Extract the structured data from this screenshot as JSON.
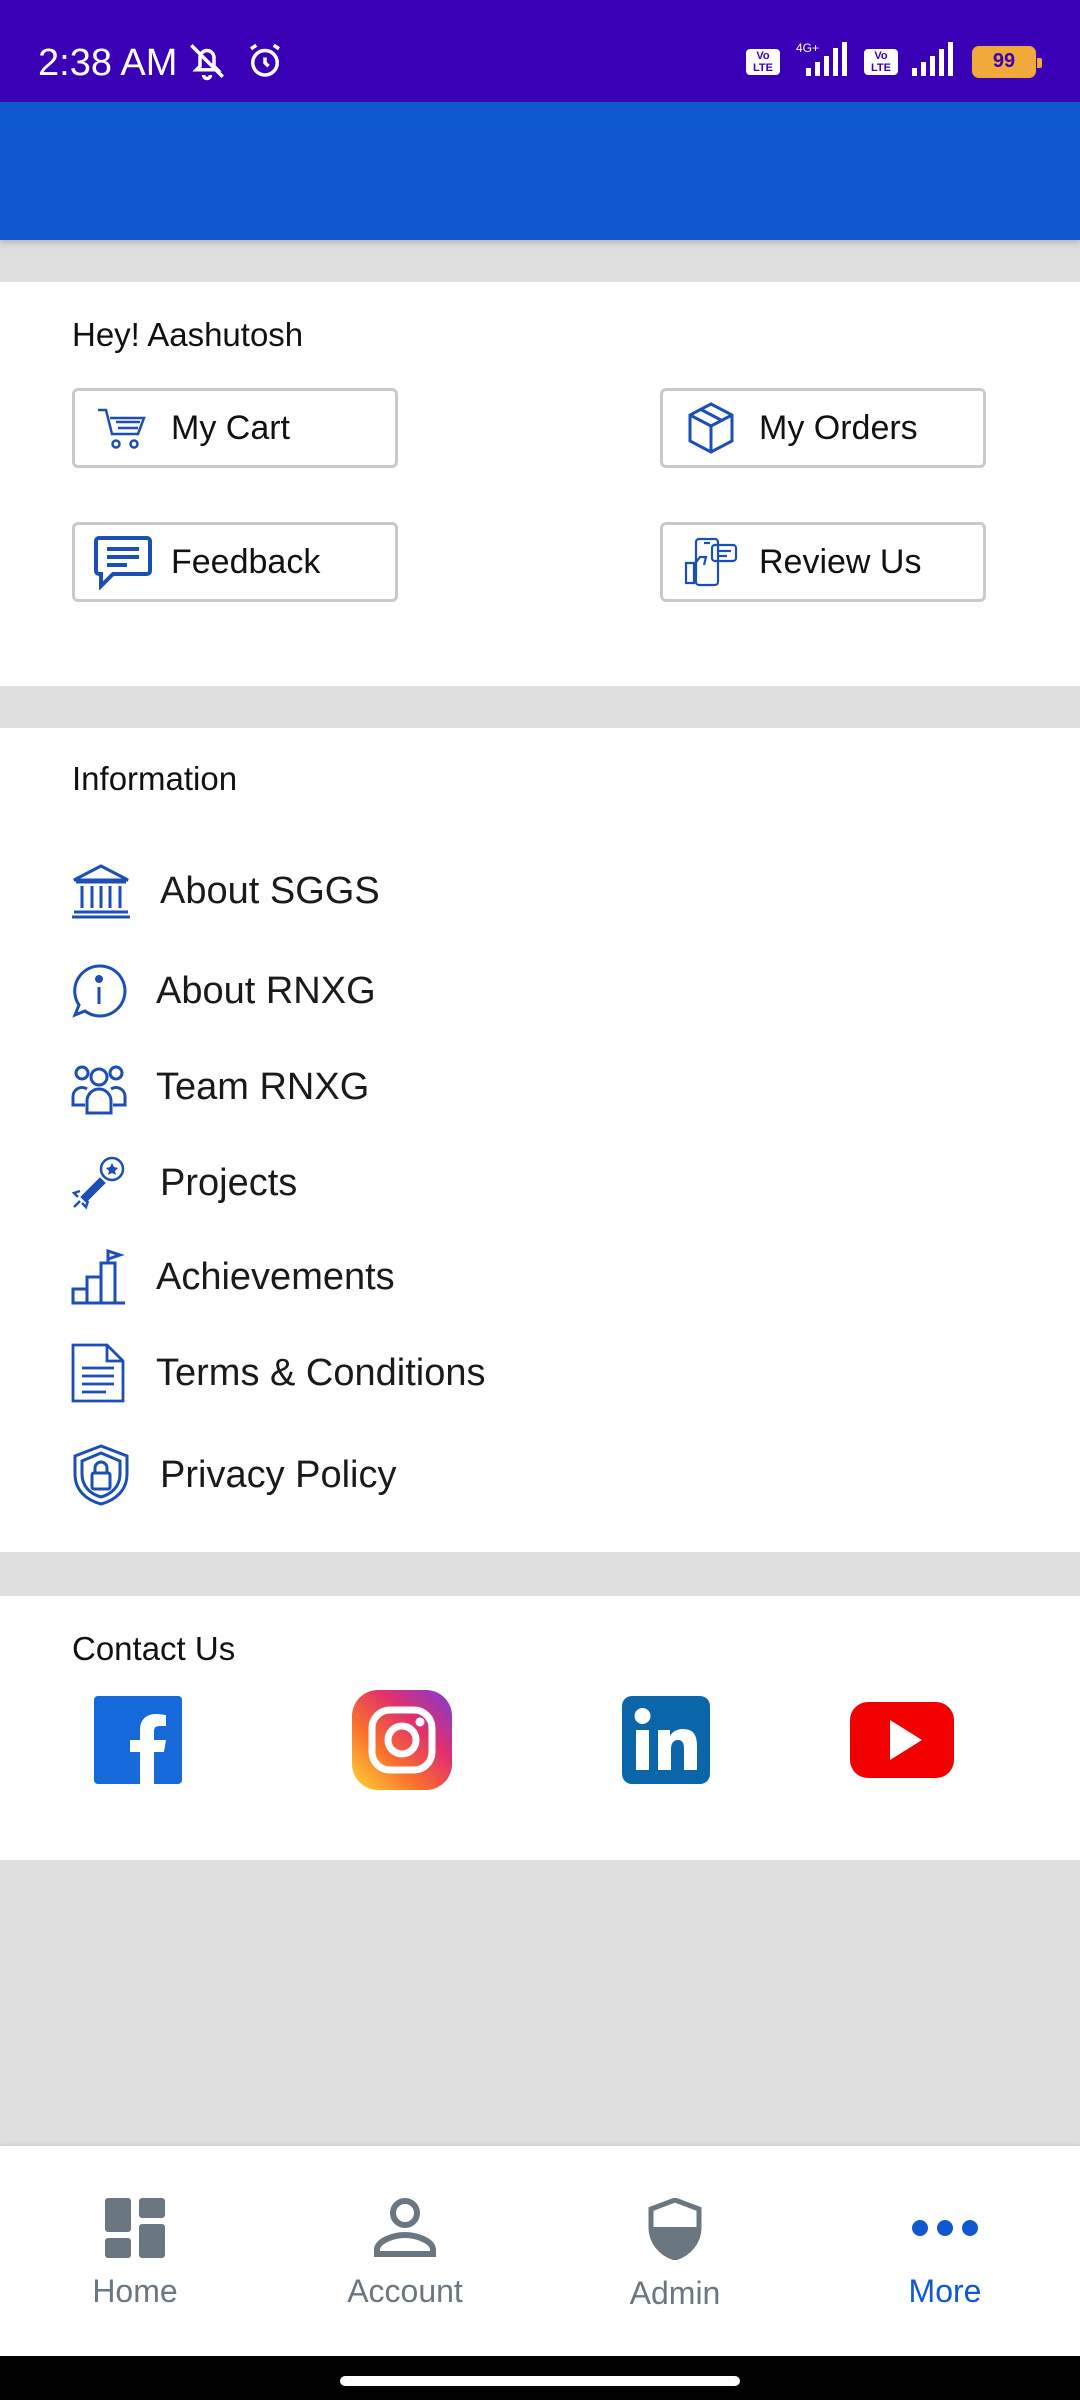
{
  "status_bar": {
    "time": "2:38 AM",
    "left_icons": [
      "mute-icon",
      "alarm-icon"
    ],
    "network": "4G+",
    "volte_label": "Vo LTE",
    "battery": "99"
  },
  "greeting": "Hey! Aashutosh",
  "quick_actions": [
    {
      "label": "My Cart",
      "icon": "cart-icon"
    },
    {
      "label": "My Orders",
      "icon": "box-icon"
    },
    {
      "label": "Feedback",
      "icon": "chat-icon"
    },
    {
      "label": "Review Us",
      "icon": "review-icon"
    }
  ],
  "information": {
    "title": "Information",
    "items": [
      {
        "label": "About SGGS",
        "icon": "institution-icon"
      },
      {
        "label": "About RNXG",
        "icon": "info-icon"
      },
      {
        "label": "Team RNXG",
        "icon": "team-icon"
      },
      {
        "label": "Projects",
        "icon": "rocket-icon"
      },
      {
        "label": "Achievements",
        "icon": "podium-icon"
      },
      {
        "label": "Terms & Conditions",
        "icon": "document-icon"
      },
      {
        "label": "Privacy Policy",
        "icon": "shield-lock-icon"
      }
    ]
  },
  "contact": {
    "title": "Contact Us",
    "socials": [
      "facebook-icon",
      "instagram-icon",
      "linkedin-icon",
      "youtube-icon"
    ]
  },
  "bottom_nav": [
    {
      "label": "Home",
      "icon": "dashboard-icon",
      "active": false
    },
    {
      "label": "Account",
      "icon": "person-icon",
      "active": false
    },
    {
      "label": "Admin",
      "icon": "shield-icon",
      "active": false
    },
    {
      "label": "More",
      "icon": "more-dots-icon",
      "active": true
    }
  ],
  "colors": {
    "status_bar": "#3a00b5",
    "app_bar": "#1058d0",
    "accent": "#1058d0",
    "icon_blue": "#1b4fb4",
    "nav_inactive": "#6b7780",
    "background": "#dedede"
  }
}
